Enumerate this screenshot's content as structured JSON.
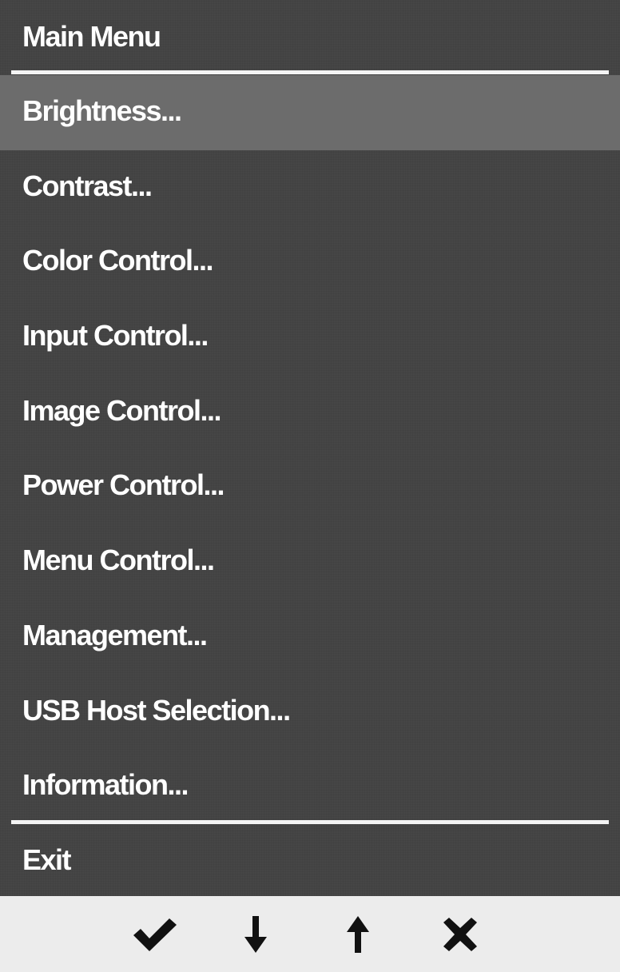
{
  "menu": {
    "title": "Main Menu",
    "items": [
      {
        "label": "Brightness...",
        "selected": true
      },
      {
        "label": "Contrast...",
        "selected": false
      },
      {
        "label": "Color Control...",
        "selected": false
      },
      {
        "label": "Input Control...",
        "selected": false
      },
      {
        "label": "Image Control...",
        "selected": false
      },
      {
        "label": "Power Control...",
        "selected": false
      },
      {
        "label": "Menu Control...",
        "selected": false
      },
      {
        "label": "Management...",
        "selected": false
      },
      {
        "label": "USB Host Selection...",
        "selected": false
      },
      {
        "label": "Information...",
        "selected": false
      }
    ],
    "exit_label": "Exit"
  },
  "buttons": [
    {
      "icon": "check-icon"
    },
    {
      "icon": "arrow-down-icon"
    },
    {
      "icon": "arrow-up-icon"
    },
    {
      "icon": "close-icon"
    }
  ],
  "colors": {
    "panel_background": "#464646",
    "selected_background": "#6c6c6c",
    "text": "#ffffff",
    "button_bar": "#ececec",
    "button_icon": "#111111"
  }
}
